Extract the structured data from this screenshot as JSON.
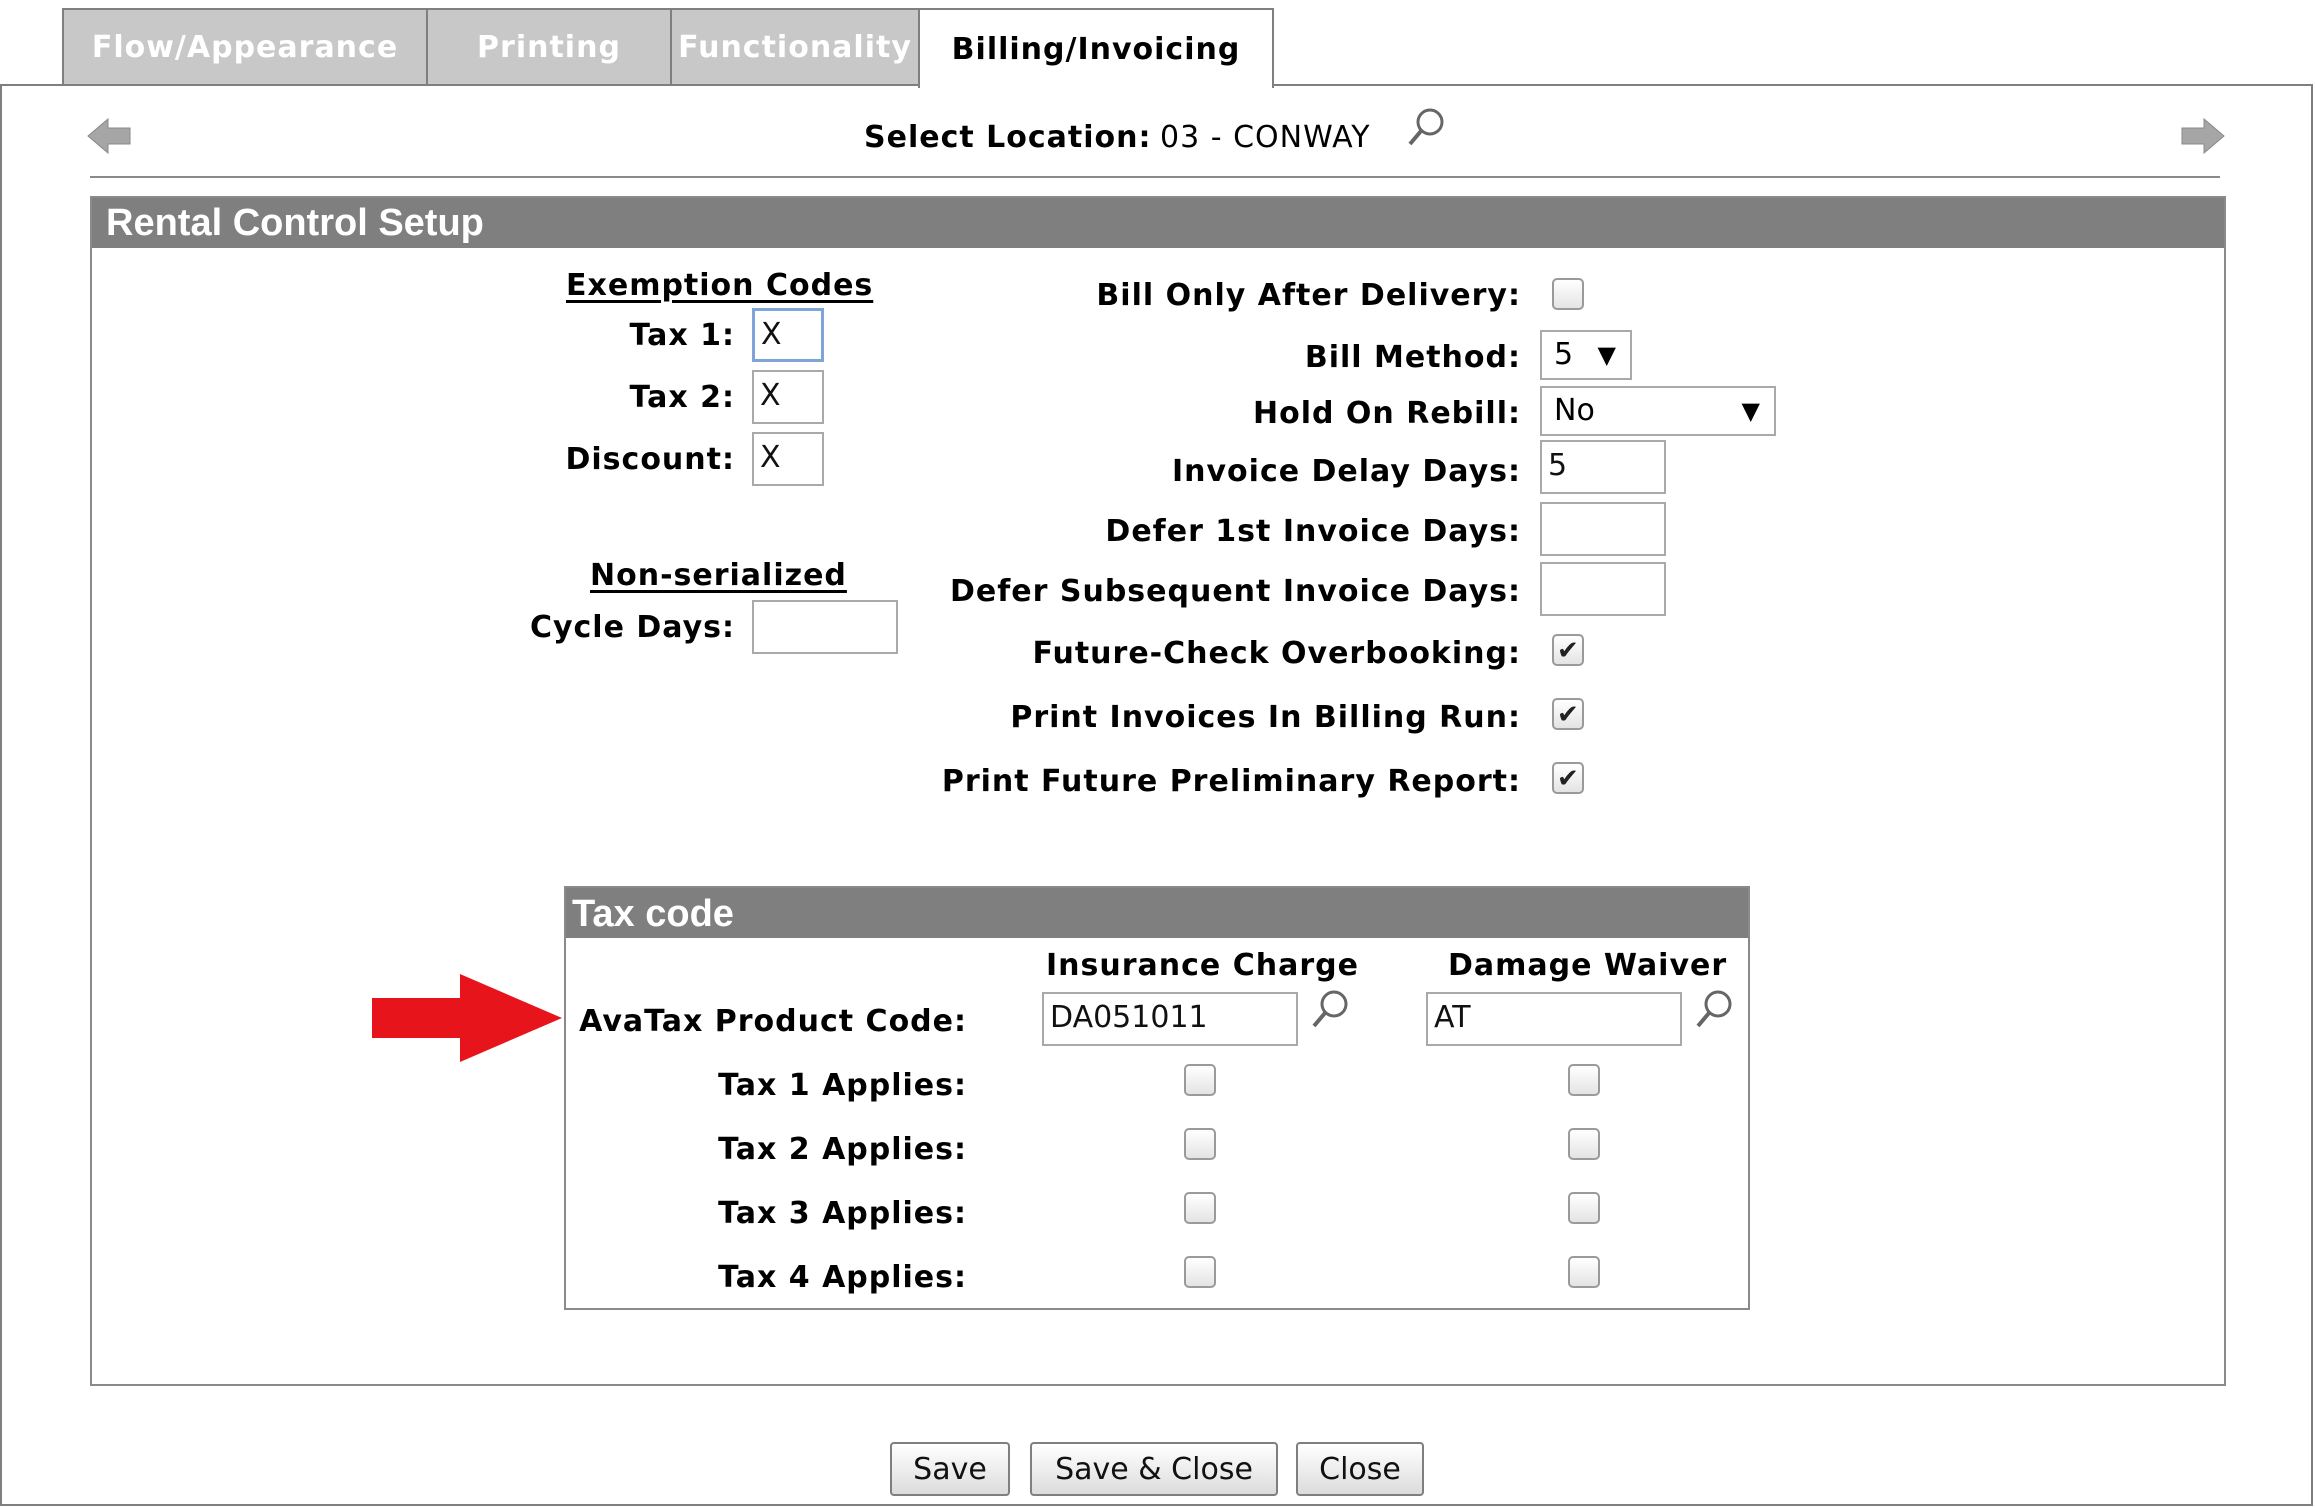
{
  "tabs": [
    {
      "label": "Flow/Appearance"
    },
    {
      "label": "Printing"
    },
    {
      "label": "Functionality"
    },
    {
      "label": "Billing/Invoicing"
    }
  ],
  "location": {
    "label": "Select Location:",
    "value": "03 - CONWAY"
  },
  "panel_title": "Rental Control Setup",
  "exemption": {
    "heading": "Exemption Codes",
    "tax1_label": "Tax 1:",
    "tax1_value": "X",
    "tax2_label": "Tax 2:",
    "tax2_value": "X",
    "discount_label": "Discount:",
    "discount_value": "X"
  },
  "nonserialized": {
    "heading": "Non-serialized",
    "cycle_label": "Cycle Days:",
    "cycle_value": ""
  },
  "billing": {
    "bill_only_label": "Bill Only After Delivery:",
    "bill_only_checked": false,
    "bill_method_label": "Bill Method:",
    "bill_method_value": "5",
    "hold_label": "Hold On Rebill:",
    "hold_value": "No",
    "delay_label": "Invoice Delay Days:",
    "delay_value": "5",
    "defer1_label": "Defer 1st Invoice Days:",
    "defer1_value": "",
    "defersub_label": "Defer Subsequent Invoice Days:",
    "defersub_value": "",
    "future_check_label": "Future-Check Overbooking:",
    "future_check_checked": true,
    "print_invoices_label": "Print Invoices In Billing Run:",
    "print_invoices_checked": true,
    "print_future_label": "Print Future Preliminary Report:",
    "print_future_checked": true
  },
  "taxcode": {
    "title": "Tax code",
    "col1": "Insurance Charge",
    "col2": "Damage Waiver",
    "avatax_label": "AvaTax Product Code:",
    "insurance_code": "DA051011",
    "damage_code": "AT",
    "rows": [
      {
        "label": "Tax 1 Applies:",
        "insurance": false,
        "damage": false
      },
      {
        "label": "Tax 2 Applies:",
        "insurance": false,
        "damage": false
      },
      {
        "label": "Tax 3 Applies:",
        "insurance": false,
        "damage": false
      },
      {
        "label": "Tax 4 Applies:",
        "insurance": false,
        "damage": false
      }
    ]
  },
  "buttons": {
    "save": "Save",
    "save_close": "Save & Close",
    "close": "Close"
  },
  "icons": {
    "prev": "left-arrow-icon",
    "next": "right-arrow-icon",
    "search": "search-icon",
    "annotation": "red-arrow-icon"
  },
  "colors": {
    "header_bg": "#7f7f7f",
    "tab_inactive": "#c8c8c8",
    "annotation_arrow": "#e8141c",
    "focus_border": "#7ea4d8"
  }
}
